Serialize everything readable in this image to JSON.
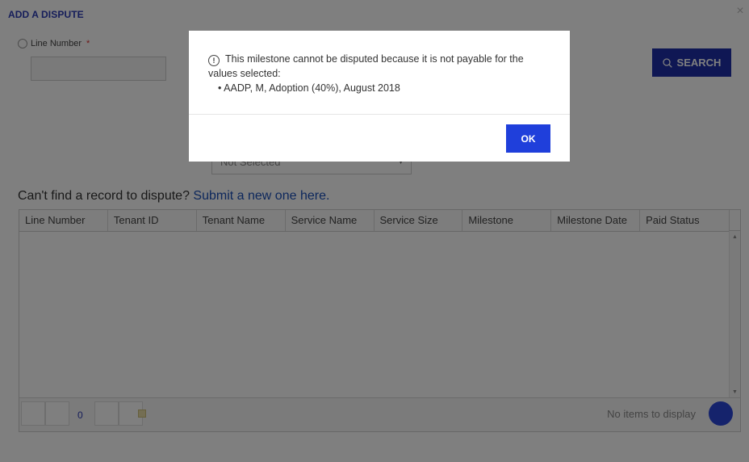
{
  "modal": {
    "title": "ADD A DISPUTE",
    "close_icon": "close-icon",
    "line_number": {
      "label": "Line Number",
      "required_mark": "*",
      "value": ""
    },
    "search_button": {
      "label": "SEARCH",
      "icon": "search-icon"
    },
    "select": {
      "value": "Not Selected"
    },
    "cant_find": {
      "prefix": "Can't find a record to dispute?",
      "link": "Submit a new one here."
    },
    "grid": {
      "columns": [
        "Line Number",
        "Tenant ID",
        "Tenant Name",
        "Service Name",
        "Service Size",
        "Milestone",
        "Milestone Date",
        "Paid Status"
      ],
      "rows": [],
      "pager": {
        "current_page": "0",
        "empty_message": "No items to display"
      }
    }
  },
  "alert": {
    "icon": "info-icon",
    "message": "This milestone cannot be disputed because it is not payable for the values selected:",
    "items": [
      "AADP, M, Adoption (40%), August 2018"
    ],
    "ok_label": "OK"
  },
  "colors": {
    "accent": "#1f3fdb",
    "title": "#2b3bb5",
    "link": "#1a4fb8"
  }
}
